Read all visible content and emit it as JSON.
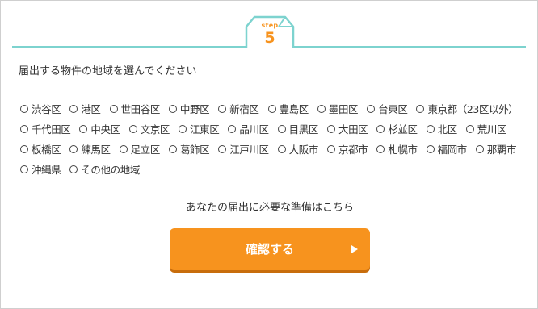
{
  "colors": {
    "teal": "#7dd3cf",
    "orange": "#f7931e",
    "orange_shadow": "#c86d0c",
    "text": "#333333"
  },
  "step": {
    "label": "step",
    "number": "5"
  },
  "heading": "届出する物件の地域を選んでください",
  "areas": [
    "渋谷区",
    "港区",
    "世田谷区",
    "中野区",
    "新宿区",
    "豊島区",
    "墨田区",
    "台東区",
    "東京都（23区以外）",
    "千代田区",
    "中央区",
    "文京区",
    "江東区",
    "品川区",
    "目黒区",
    "大田区",
    "杉並区",
    "北区",
    "荒川区",
    "板橋区",
    "練馬区",
    "足立区",
    "葛飾区",
    "江戸川区",
    "大阪市",
    "京都市",
    "札幌市",
    "福岡市",
    "那覇市",
    "沖縄県",
    "その他の地域"
  ],
  "prompt": "あなたの届出に必要な準備はこちら",
  "confirm_button": {
    "label": "確認する",
    "icon": "play-icon"
  }
}
